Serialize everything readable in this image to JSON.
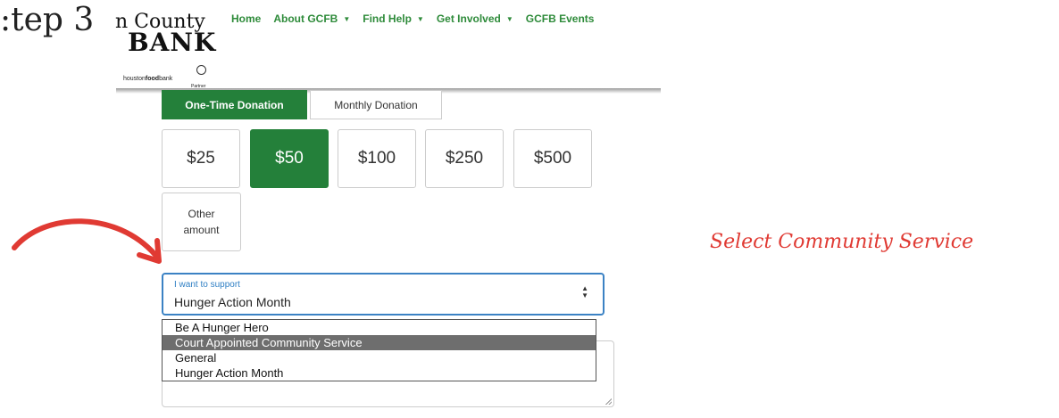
{
  "step_label": "tep 3:",
  "logo": {
    "county": "n County",
    "bank": "BANK",
    "partner_prefix": "houston",
    "partner_food": "food",
    "partner_suffix": "bank",
    "partner_sub": "Partner"
  },
  "nav": {
    "items": [
      {
        "label": "Home",
        "has_caret": false
      },
      {
        "label": "About GCFB",
        "has_caret": true
      },
      {
        "label": "Find Help",
        "has_caret": true
      },
      {
        "label": "Get Involved",
        "has_caret": true
      },
      {
        "label": "GCFB Events",
        "has_caret": false
      }
    ],
    "caret_icon": "chevron-down-icon"
  },
  "donation": {
    "frequency": {
      "one_time": "One-Time Donation",
      "monthly": "Monthly Donation",
      "selected": "One-Time Donation"
    },
    "amounts": [
      "$25",
      "$50",
      "$100",
      "$250",
      "$500"
    ],
    "selected_amount": "$50",
    "other_line1": "Other",
    "other_line2": "amount"
  },
  "support_select": {
    "label": "I want to support",
    "value": "Hunger Action Month",
    "options": [
      "Be A Hunger Hero",
      "Court Appointed Community Service",
      "General",
      "Hunger Action Month"
    ],
    "highlighted": "Court Appointed Community Service"
  },
  "annotation": "Select Community Service",
  "colors": {
    "brand_green": "#24803a",
    "nav_green": "#2e8b3a",
    "focus_blue": "#3b82c4",
    "annotation_red": "#e03a33"
  }
}
